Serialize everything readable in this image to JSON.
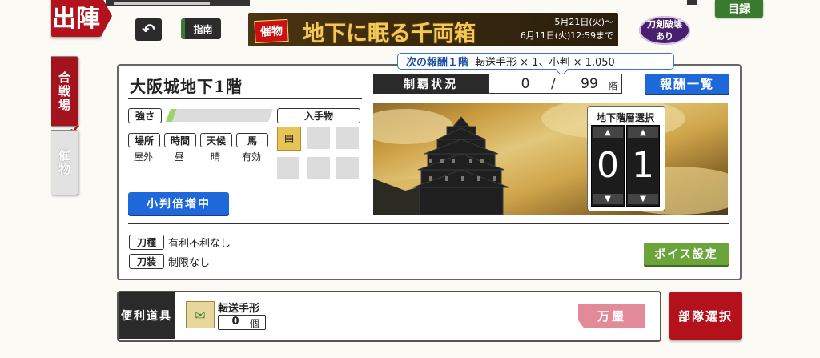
{
  "header": {
    "title": "出陣",
    "catalog_label": "目録",
    "guide_label": "指南",
    "back_icon": "back-arrow-icon"
  },
  "event_banner": {
    "tag": "催物",
    "title": "地下に眠る千両箱",
    "date_start": "5月21日(火)〜",
    "date_end": "6月11日(火)12:59まで"
  },
  "break_badge": {
    "line1": "刀剣破壊",
    "line2": "あり"
  },
  "side_tabs": [
    {
      "label": "合戦場",
      "active": false
    },
    {
      "label": "催物",
      "active": true
    }
  ],
  "stage": {
    "title": "大阪城地下1階",
    "strength_label": "強さ",
    "strength_level": 0.06,
    "items_label": "入手物",
    "attributes": {
      "location": {
        "label": "場所",
        "value": "屋外"
      },
      "time": {
        "label": "時間",
        "value": "昼"
      },
      "weather": {
        "label": "天候",
        "value": "晴"
      },
      "horse": {
        "label": "馬",
        "value": "有効"
      }
    },
    "koban_button": "小判倍増中"
  },
  "next_reward": {
    "label": "次の報酬１階",
    "text": "転送手形 × 1、小判 × 1,050"
  },
  "conquest": {
    "label": "制覇状況",
    "current": "0",
    "separator": "/",
    "total": "99",
    "unit": "階"
  },
  "reward_list_label": "報酬一覧",
  "floor_selector": {
    "label": "地下階層選択",
    "tens": "0",
    "ones": "1"
  },
  "restrictions": {
    "sword_type_label": "刀種",
    "sword_type_value": "有利不利なし",
    "equipment_label": "刀装",
    "equipment_value": "制限なし"
  },
  "voice_button": "ボイス設定",
  "tools": {
    "label": "便利道具",
    "item_name": "転送手形",
    "item_count": "0",
    "item_unit": "個",
    "shop_label": "万屋"
  },
  "team_select_label": "部隊選択",
  "colors": {
    "accent_red": "#b3121c",
    "action_blue": "#1f68d9",
    "voice_green": "#6aa43a"
  }
}
